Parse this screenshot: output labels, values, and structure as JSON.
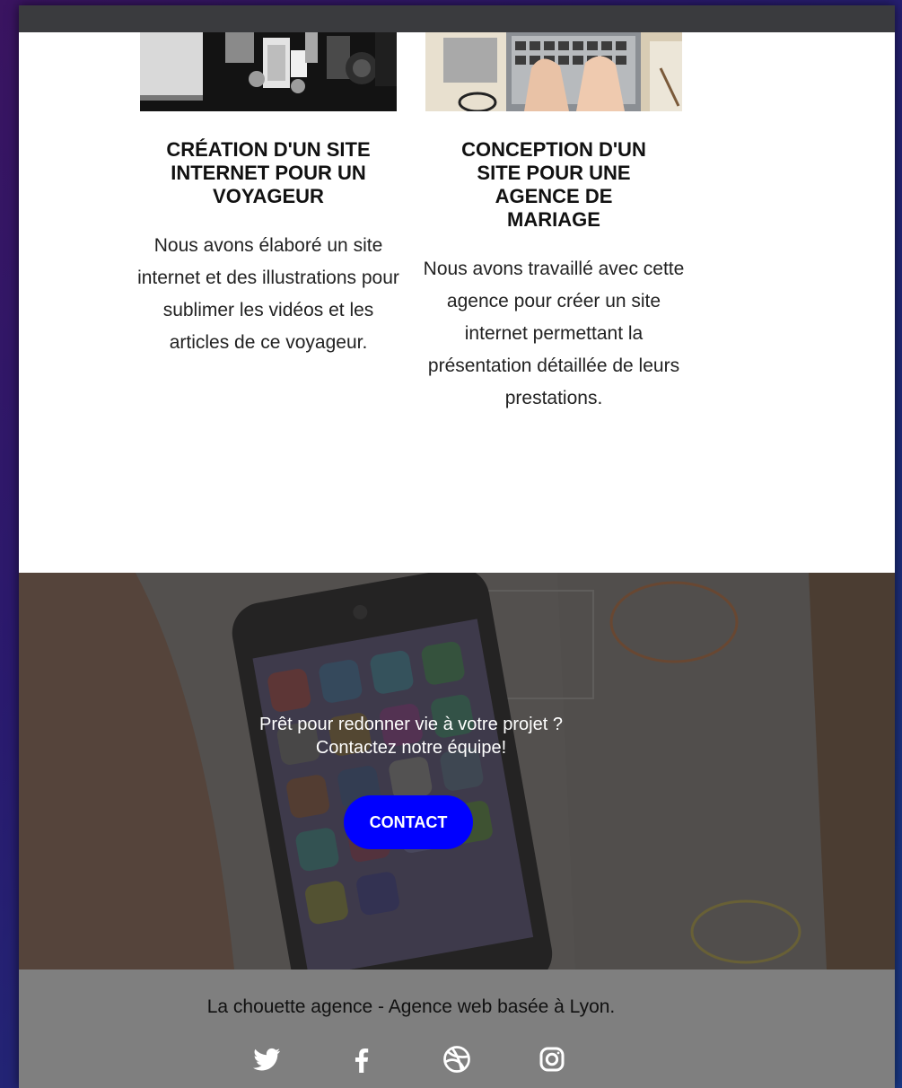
{
  "projects": [
    {
      "title": "CRÉATION D'UN SITE INTERNET POUR UN VOYAGEUR",
      "description": "Nous avons élaboré un site internet et des illustrations pour sublimer les vidéos et les articles de ce voyageur."
    },
    {
      "title": "CONCEPTION D'UN SITE POUR UNE AGENCE DE MARIAGE",
      "description": "Nous avons travaillé avec cette agence pour créer un site internet permettant la présentation détaillée de leurs prestations."
    }
  ],
  "cta": {
    "line1": "Prêt pour redonner vie à votre projet ?",
    "line2": "Contactez notre équipe!",
    "button_label": "CONTACT"
  },
  "footer": {
    "tagline": "La chouette agence - Agence web basée à Lyon.",
    "social_icons": [
      "twitter-icon",
      "facebook-icon",
      "dribbble-icon",
      "instagram-icon"
    ]
  },
  "colors": {
    "button_bg": "#0000ff",
    "footer_bg": "#7f7f7f",
    "topbar_bg": "#3a3b3e"
  }
}
